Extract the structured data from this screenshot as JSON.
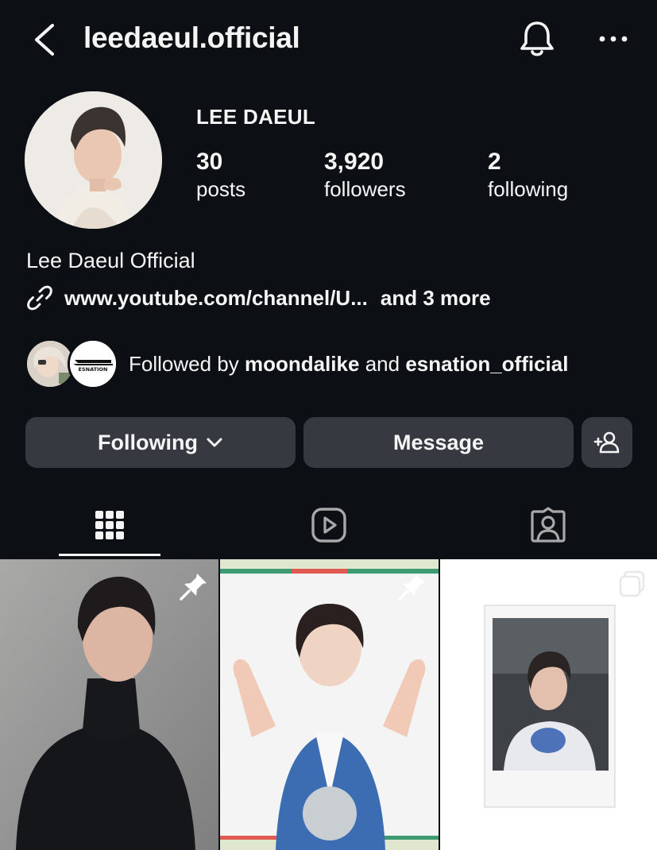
{
  "header": {
    "username": "leedaeul.official",
    "back_icon": "chevron-left-icon",
    "bell_icon": "bell-icon",
    "more_icon": "more-horizontal-icon"
  },
  "profile": {
    "display_name": "LEE DAEUL",
    "stats": [
      {
        "value": "30",
        "label": "posts"
      },
      {
        "value": "3,920",
        "label": "followers"
      },
      {
        "value": "2",
        "label": "following"
      }
    ],
    "bio_name": "Lee Daeul Official",
    "link": {
      "text": "www.youtube.com/channel/U...",
      "more": "and 3 more"
    },
    "followed_by": {
      "prefix": "Followed by",
      "user1": "moondalike",
      "joiner": "and",
      "user2": "esnation_official",
      "avatar2_text": "ESNATION"
    }
  },
  "actions": {
    "following_label": "Following",
    "message_label": "Message"
  },
  "colors": {
    "background": "#0c1014",
    "button_bg": "#363a40",
    "text": "#f5f5f5",
    "icon_gray": "#a8a8a8"
  }
}
